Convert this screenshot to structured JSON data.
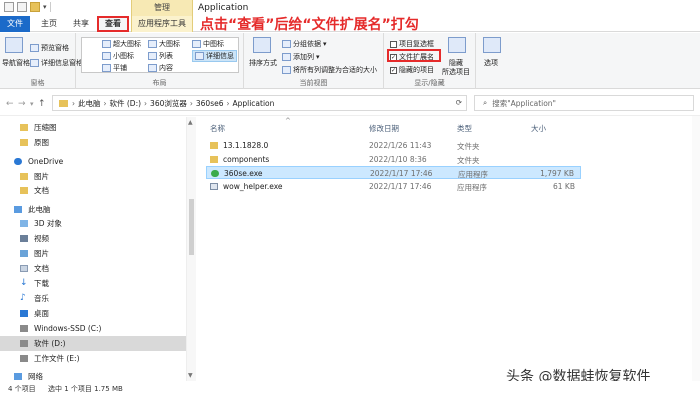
{
  "window": {
    "title": "Application",
    "tools_tab_header": "管理"
  },
  "tabs": {
    "file": "文件",
    "home": "主页",
    "share": "共享",
    "view": "查看",
    "app_tools": "应用程序工具"
  },
  "instruction": "点击“查看”后给“文件扩展名”打勾",
  "ribbon": {
    "panes": {
      "nav_pane": "导航窗格",
      "preview": "预览窗格",
      "details": "详细信息窗格",
      "label": "窗格"
    },
    "layout": {
      "extra_large": "超大图标",
      "large": "大图标",
      "medium": "中图标",
      "small": "小图标",
      "list": "列表",
      "details": "详细信息",
      "tiles": "平铺",
      "content": "内容",
      "label": "布局"
    },
    "current_view": {
      "sort_by": "排序方式",
      "group_by": "分组依据",
      "add_columns": "添加列",
      "size_all": "将所有列调整为合适的大小",
      "label": "当前视图"
    },
    "show_hide": {
      "item_checkboxes": "项目复选框",
      "file_extensions": "文件扩展名",
      "hidden_items": "隐藏的项目",
      "hide_selected_1": "隐藏",
      "hide_selected_2": "所选项目",
      "label": "显示/隐藏",
      "item_checkboxes_checked": false,
      "file_extensions_checked": true,
      "hidden_items_checked": true
    },
    "options": "选项"
  },
  "address": {
    "crumbs": [
      "此电脑",
      "软件 (D:)",
      "360浏览器",
      "360se6",
      "Application"
    ],
    "search_placeholder": "搜索\"Application\""
  },
  "nav_pane": {
    "items": [
      {
        "label": "压缩图",
        "icon": "folder-icon"
      },
      {
        "label": "原图",
        "icon": "folder-icon"
      },
      {
        "label": "OneDrive",
        "icon": "cloud-icon"
      },
      {
        "label": "图片",
        "icon": "folder-icon"
      },
      {
        "label": "文档",
        "icon": "folder-icon"
      },
      {
        "label": "此电脑",
        "icon": "computer-icon"
      },
      {
        "label": "3D 对象",
        "icon": "cube-icon"
      },
      {
        "label": "视频",
        "icon": "video-icon"
      },
      {
        "label": "图片",
        "icon": "pictures-icon"
      },
      {
        "label": "文档",
        "icon": "document-icon"
      },
      {
        "label": "下载",
        "icon": "download-icon"
      },
      {
        "label": "音乐",
        "icon": "music-icon"
      },
      {
        "label": "桌面",
        "icon": "desktop-icon"
      },
      {
        "label": "Windows-SSD (C:)",
        "icon": "drive-icon"
      },
      {
        "label": "软件 (D:)",
        "icon": "drive-icon"
      },
      {
        "label": "工作文件 (E:)",
        "icon": "drive-icon"
      },
      {
        "label": "网络",
        "icon": "network-icon"
      }
    ]
  },
  "columns": {
    "name": "名称",
    "date": "修改日期",
    "type": "类型",
    "size": "大小"
  },
  "files": [
    {
      "name": "13.1.1828.0",
      "date": "2022/1/26 11:43",
      "type": "文件夹",
      "size": "",
      "icon": "folder-icon"
    },
    {
      "name": "components",
      "date": "2022/1/10 8:36",
      "type": "文件夹",
      "size": "",
      "icon": "folder-icon"
    },
    {
      "name": "360se.exe",
      "date": "2022/1/17 17:46",
      "type": "应用程序",
      "size": "1,797 KB",
      "icon": "browser-icon"
    },
    {
      "name": "wow_helper.exe",
      "date": "2022/1/17 17:46",
      "type": "应用程序",
      "size": "61 KB",
      "icon": "exe-icon"
    }
  ],
  "status": {
    "count": "4 个项目",
    "selection": "选中 1 个项目  1.75 MB"
  },
  "watermark": "头条 @数据蛙恢复软件",
  "colors": {
    "accent": "#1b6ac9",
    "highlight_red": "#e52b2b",
    "selection": "#cce8ff"
  }
}
